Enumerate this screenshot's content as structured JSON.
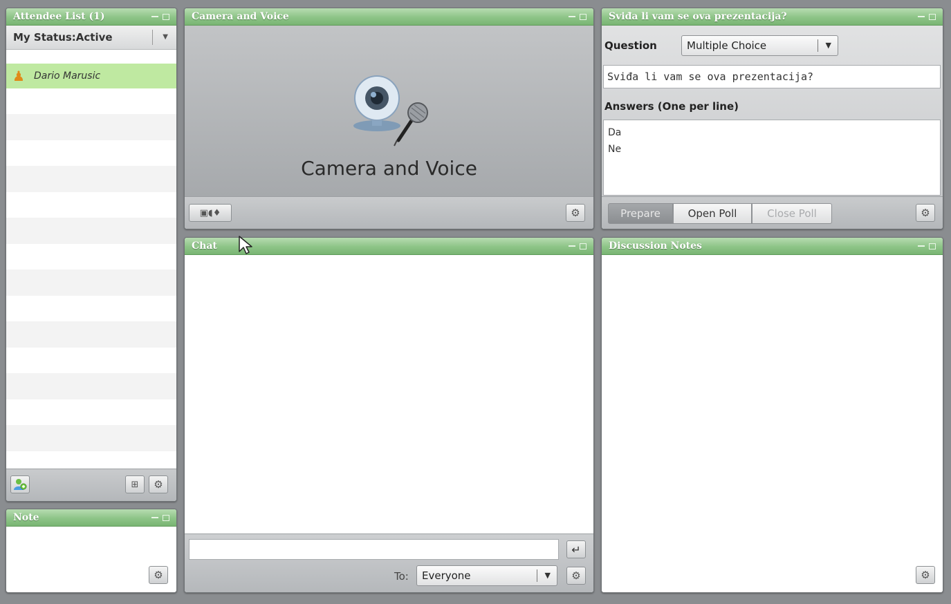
{
  "attendee": {
    "title": "Attendee List (1)",
    "status": "My Status:Active",
    "users": [
      {
        "name": "Dario Marusic"
      }
    ]
  },
  "note": {
    "title": "Note"
  },
  "camera": {
    "title": "Camera and Voice",
    "label": "Camera and Voice"
  },
  "poll": {
    "title": "Sviđa li vam se ova prezentacija?",
    "question_label": "Question",
    "question_type": "Multiple Choice",
    "question_text": "Sviđa li vam se ova prezentacija?",
    "answers_label": "Answers (One per line)",
    "answers": [
      "Da",
      "Ne"
    ],
    "buttons": {
      "prepare": "Prepare",
      "open": "Open Poll",
      "close": "Close Poll"
    }
  },
  "chat": {
    "title": "Chat",
    "to_label": "To:",
    "to_value": "Everyone"
  },
  "notes": {
    "title": "Discussion Notes"
  },
  "icons": {
    "settings": "gear-icon",
    "camera": "webcam-icon",
    "microphone": "microphone-icon",
    "send": "return-icon",
    "user": "user-icon"
  },
  "colors": {
    "titlebar": "#8dc487",
    "attendee_highlight": "#bfe9a1"
  }
}
